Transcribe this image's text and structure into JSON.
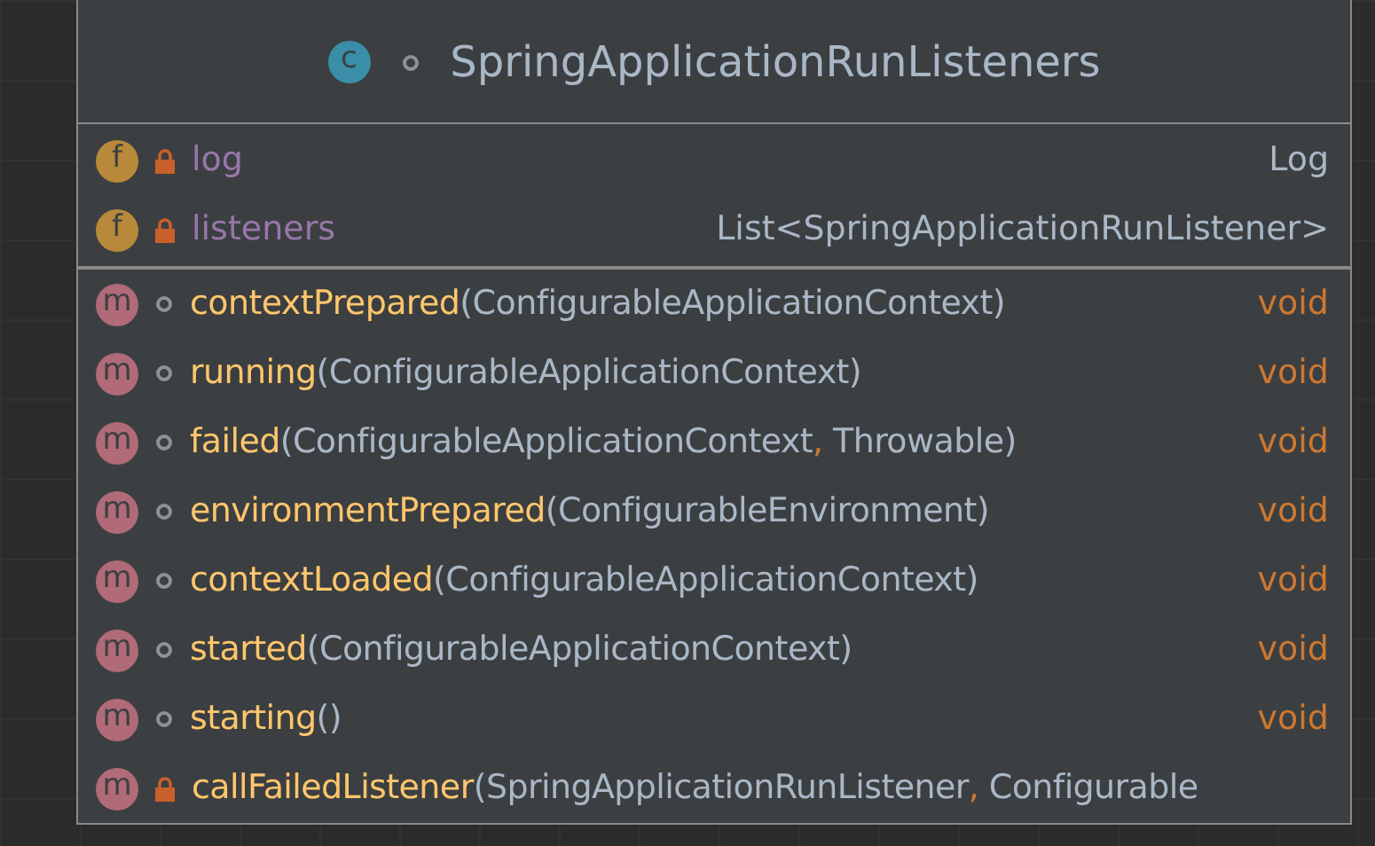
{
  "class_node": {
    "icon_letter": "c",
    "private": false,
    "title": "SpringApplicationRunListeners"
  },
  "fields": [
    {
      "icon_letter": "f",
      "private": true,
      "name": "log",
      "type": "Log"
    },
    {
      "icon_letter": "f",
      "private": true,
      "name": "listeners",
      "type": "List<SpringApplicationRunListener>"
    }
  ],
  "methods": [
    {
      "icon_letter": "m",
      "private": false,
      "name": "contextPrepared",
      "params": "(ConfigurableApplicationContext)",
      "return_type": "void"
    },
    {
      "icon_letter": "m",
      "private": false,
      "name": "running",
      "params": "(ConfigurableApplicationContext)",
      "return_type": "void"
    },
    {
      "icon_letter": "m",
      "private": false,
      "name": "failed",
      "params": "(ConfigurableApplicationContext, Throwable)",
      "return_type": "void"
    },
    {
      "icon_letter": "m",
      "private": false,
      "name": "environmentPrepared",
      "params": "(ConfigurableEnvironment)",
      "return_type": "void"
    },
    {
      "icon_letter": "m",
      "private": false,
      "name": "contextLoaded",
      "params": "(ConfigurableApplicationContext)",
      "return_type": "void"
    },
    {
      "icon_letter": "m",
      "private": false,
      "name": "started",
      "params": "(ConfigurableApplicationContext)",
      "return_type": "void"
    },
    {
      "icon_letter": "m",
      "private": false,
      "name": "starting",
      "params": "()",
      "return_type": "void"
    },
    {
      "icon_letter": "m",
      "private": true,
      "name": "callFailedListener",
      "params": "(SpringApplicationRunListener, Configurable"
    }
  ]
}
